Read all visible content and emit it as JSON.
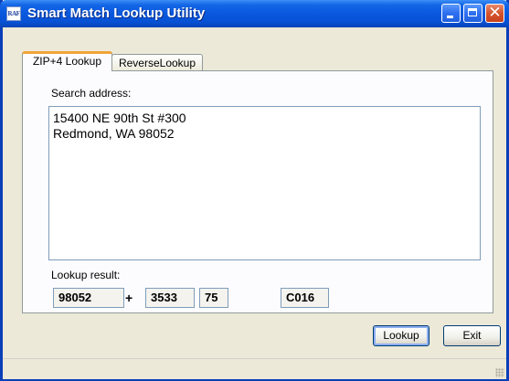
{
  "window": {
    "title": "Smart Match Lookup Utility",
    "icon_text": "RAF",
    "controls": [
      "minimize-icon",
      "maximize-icon",
      "close-icon"
    ],
    "close_glyph": "✕"
  },
  "tabs": [
    {
      "label": "ZIP+4 Lookup",
      "active": true
    },
    {
      "label": "ReverseLookup",
      "active": false
    }
  ],
  "search": {
    "label": "Search address:",
    "lines": [
      "15400 NE 90th St #300",
      "Redmond, WA  98052"
    ]
  },
  "result": {
    "label": "Lookup result:",
    "zip5": "98052",
    "plus": "+",
    "zip4": "3533",
    "delivery_point": "75",
    "carrier_route": "C016"
  },
  "buttons": {
    "lookup": "Lookup",
    "exit": "Exit"
  },
  "colors": {
    "titlebar": "#0a58de",
    "active_tab_accent": "#f0a438",
    "window_bg": "#ece9d8"
  }
}
